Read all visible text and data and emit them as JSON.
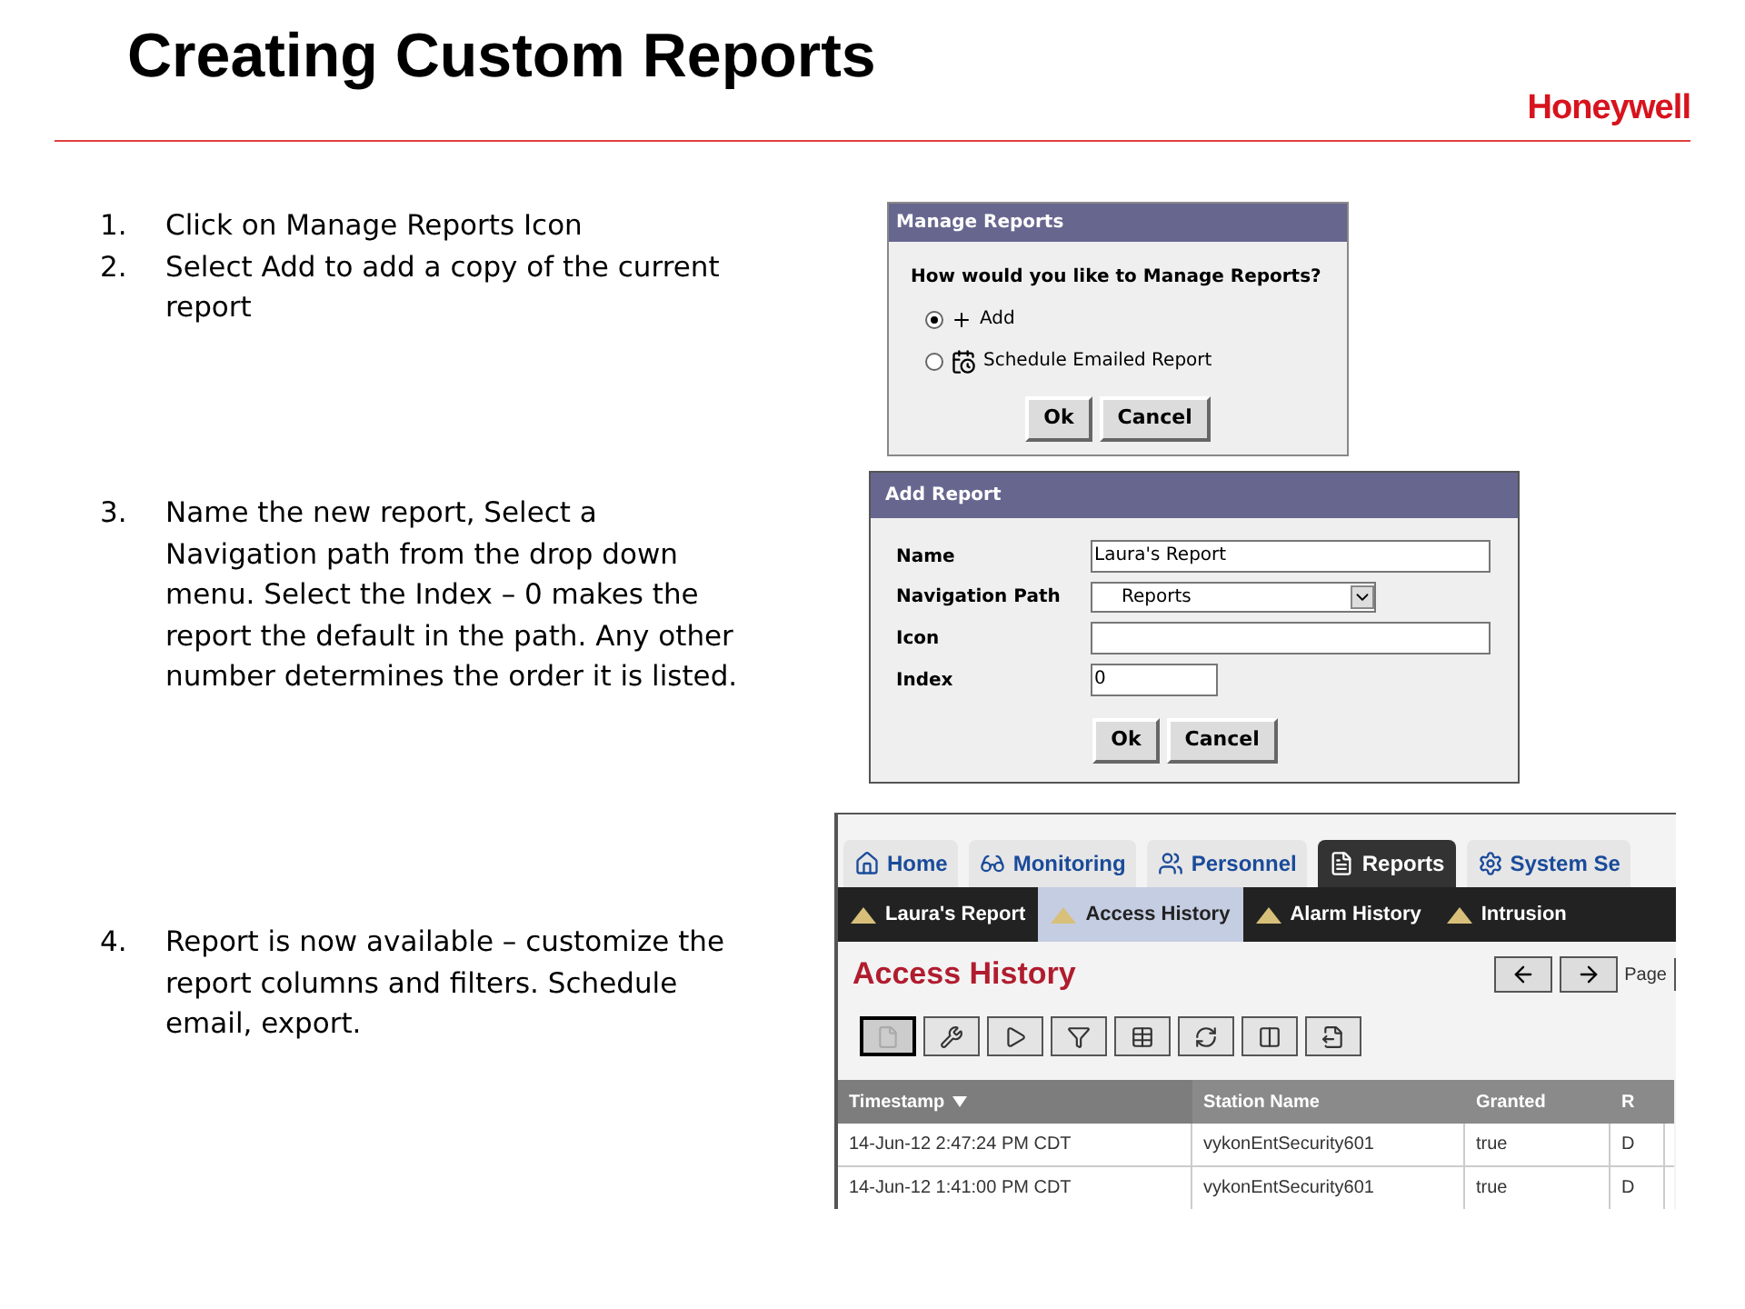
{
  "title": "Creating Custom Reports",
  "logo": "Honeywell",
  "sections": [
    {
      "steps": [
        {
          "number": "1.",
          "text": "Click on Manage Reports Icon"
        },
        {
          "number": "2.",
          "text": "Select Add to add a copy of the current report"
        }
      ],
      "screenshot": {
        "kind": "manage_dialog",
        "title": "Manage Reports",
        "question": "How would you like to Manage Reports?",
        "options": [
          {
            "label": "Add",
            "selected": true
          },
          {
            "label": "Schedule Emailed Report",
            "selected": false
          }
        ],
        "buttons": [
          "Ok",
          "Cancel"
        ]
      }
    },
    {
      "steps": [
        {
          "number": "3.",
          "text": "Name the new report, Select a Navigation path from the drop down menu.  Select the Index – 0 makes the report the default in the path. Any other number determines the order it is listed."
        }
      ],
      "screenshot": {
        "kind": "add_dialog",
        "title": "Add Report",
        "fields": [
          {
            "label": "Name",
            "kind": "text",
            "value": "Laura's Report"
          },
          {
            "label": "Navigation Path",
            "kind": "select",
            "value": "Reports"
          },
          {
            "label": "Icon",
            "kind": "text"
          },
          {
            "label": "Index",
            "kind": "short",
            "value": "0"
          }
        ],
        "buttons": [
          "Ok",
          "Cancel"
        ]
      }
    },
    {
      "steps": [
        {
          "number": "4.",
          "text": "Report is now available – customize the report columns and filters. Schedule email, export."
        }
      ],
      "screenshot": {
        "kind": "app",
        "tabs": [
          {
            "label": "Home",
            "selected": false
          },
          {
            "label": "Monitoring",
            "selected": false
          },
          {
            "label": "Personnel",
            "selected": false
          },
          {
            "label": "Reports",
            "selected": true
          },
          {
            "label": "System Se",
            "selected": false
          }
        ],
        "subtabs": [
          {
            "label": "Laura's Report",
            "selected": false
          },
          {
            "label": "Access History",
            "selected": true
          },
          {
            "label": "Alarm History",
            "selected": false
          },
          {
            "label": "Intrusion",
            "selected": false
          }
        ],
        "heading": "Access History",
        "page_label": "Page",
        "columns": [
          {
            "label": "Timestamp",
            "sorted": true
          },
          {
            "label": "Station Name",
            "sorted": false
          },
          {
            "label": "Granted",
            "sorted": false
          },
          {
            "label": "R",
            "sorted": false
          }
        ],
        "rows": [
          [
            "14-Jun-12 2:47:24 PM CDT",
            "vykonEntSecurity601",
            "true",
            "D"
          ],
          [
            "14-Jun-12 1:41:00 PM CDT",
            "vykonEntSecurity601",
            "true",
            "D"
          ]
        ]
      }
    }
  ]
}
